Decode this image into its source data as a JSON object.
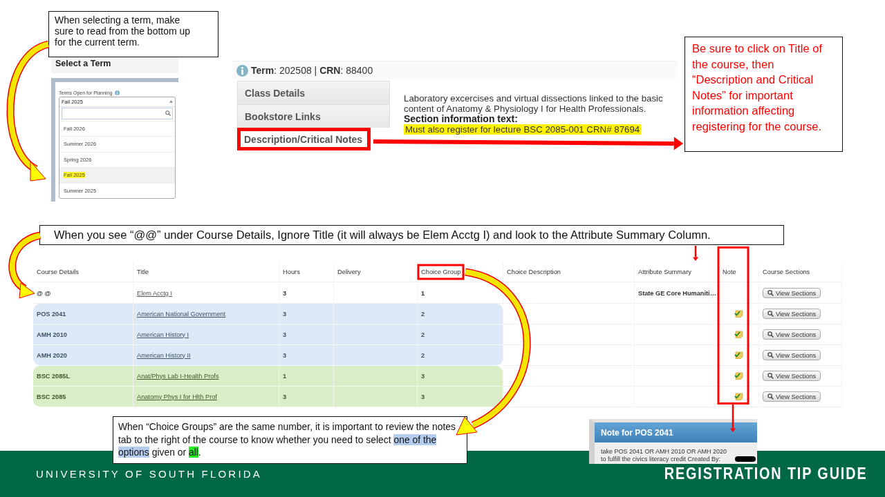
{
  "term_callout": {
    "text": "When selecting a term, make sure to read from the bottom up for the current term."
  },
  "term_picker": {
    "title": "Select a Term",
    "label": "Terms Open for Planning",
    "value": "Fall 2025",
    "options": [
      {
        "label": "Fall 2026",
        "selected": false
      },
      {
        "label": "Summer 2026",
        "selected": false
      },
      {
        "label": "Spring 2026",
        "selected": false
      },
      {
        "label": "Fall 2025",
        "selected": true
      },
      {
        "label": "Summer 2025",
        "selected": false
      }
    ]
  },
  "class_details": {
    "header": "**Term**: 202508 | **CRN**: 88400",
    "tabs": [
      {
        "label": "Class Details",
        "selected": false
      },
      {
        "label": "Bookstore Links",
        "selected": false
      },
      {
        "label": "Description/Critical Notes",
        "selected": true
      }
    ],
    "description": "Laboratory excercises and virtual dissections linked to the basic content of Anatomy & Physiology I for Health Professionals.",
    "section_heading": "Section information text:",
    "section_note": {
      "text": "Must also register for lecture BSC 2085-001 CRN# 87694",
      "highlighted": true
    }
  },
  "title_callout": {
    "text": "Be sure to click on Title of the course, then “Description and Critical Notes” for important information affecting registering for the course."
  },
  "course_callout": {
    "text": "When you see “@@” under Course Details, Ignore Title (it will always be Elem Acctg I) and look to the Attribute Summary Column."
  },
  "plan_table": {
    "columns": [
      "Course Details",
      "Title",
      "Hours",
      "Delivery",
      "Choice Group",
      "Choice Description",
      "Attribute Summary",
      "Note",
      "Course Sections"
    ],
    "rows": [
      {
        "course": "@ @",
        "title": "Elem Acctg I",
        "hours": "3",
        "choice_group": "1",
        "attribute": "State GE Core Humaniti…",
        "has_note": false,
        "action": "View Sections"
      },
      {
        "course": "POS 2041",
        "title": "American National Government",
        "hours": "3",
        "choice_group": "2",
        "has_note": true,
        "action": "View Sections",
        "color": "#dde9f6"
      },
      {
        "course": "AMH 2010",
        "title": "American History I",
        "hours": "3",
        "choice_group": "2",
        "has_note": true,
        "action": "View Sections",
        "color": "#dde9f6"
      },
      {
        "course": "AMH 2020",
        "title": "American History II",
        "hours": "3",
        "choice_group": "2",
        "has_note": true,
        "action": "View Sections",
        "color": "#dde9f6"
      },
      {
        "course": "BSC 2085L",
        "title": "Anat/Phys Lab I-Health Profs",
        "hours": "1",
        "choice_group": "3",
        "has_note": true,
        "action": "View Sections",
        "color": "#d9edc6"
      },
      {
        "course": "BSC 2085",
        "title": "Anatomy Phys I for Hlth Prof",
        "hours": "3",
        "choice_group": "3",
        "has_note": true,
        "action": "View Sections",
        "color": "#d9edc6"
      }
    ]
  },
  "choice_callout": {
    "segments": [
      {
        "text": "When “Choice Groups” are the same number, it is important to review the notes tab to the right of the course to know whether you need to select "
      },
      {
        "text": "one of the options",
        "color": "#b4cdee"
      },
      {
        "text": " given or "
      },
      {
        "text": "all",
        "color": "#22ee22"
      },
      {
        "text": "."
      }
    ]
  },
  "note_popup": {
    "title": "Note for POS 2041",
    "text": "take POS 2041 OR AMH 2010 OR AMH 2020 to fulfill the civics literacy credit Created By:"
  },
  "footer": {
    "university": "UNIVERSITY OF SOUTH FLORIDA",
    "guide": "REGISTRATION TIP GUIDE"
  }
}
